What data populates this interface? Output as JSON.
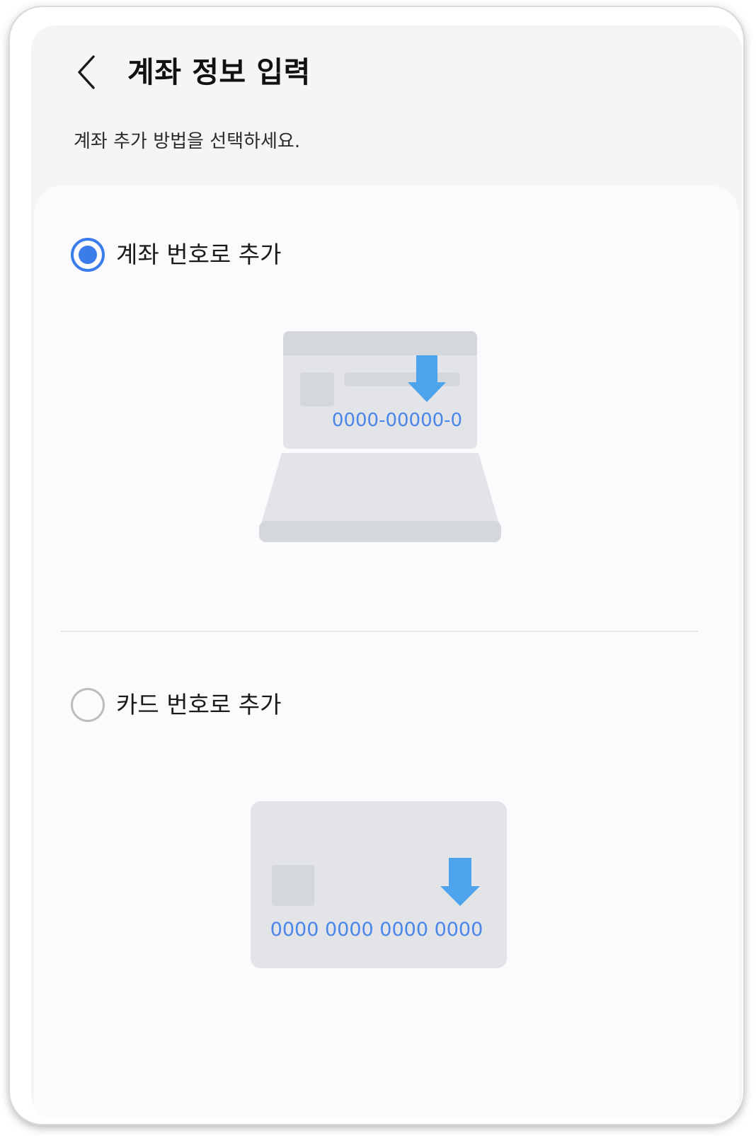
{
  "header": {
    "title": "계좌 정보 입력",
    "back_icon": "chevron-left-icon"
  },
  "subtitle": "계좌 추가 방법을 선택하세요.",
  "options": [
    {
      "label": "계좌 번호로 추가",
      "selected": true,
      "illustration_text": "0000-00000-0",
      "illustration_icon": "laptop-icon"
    },
    {
      "label": "카드 번호로 추가",
      "selected": false,
      "illustration_text": "0000 0000 0000 0000",
      "illustration_icon": "credit-card-icon"
    }
  ],
  "colors": {
    "accent": "#3a7dea",
    "arrow": "#4da3ec",
    "illustration_gray": "#e2e4e8"
  }
}
